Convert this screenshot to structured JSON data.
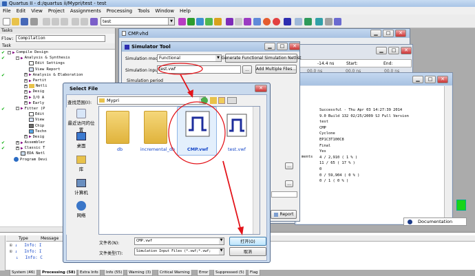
{
  "app": {
    "title": "Quartus II - d:/quartus ii/Mypri/test - test"
  },
  "menu": [
    "File",
    "Edit",
    "View",
    "Project",
    "Assignments",
    "Processing",
    "Tools",
    "Window",
    "Help"
  ],
  "toolbar": {
    "project_combo": "test"
  },
  "tasks": {
    "title": "Tasks",
    "flow_label": "Flow:",
    "flow_value": "Compilation",
    "col_task": "Task",
    "items": [
      {
        "label": "Compile Design",
        "check": true,
        "indent": 0,
        "type": "tri"
      },
      {
        "label": "Analysis & Synthesis",
        "check": true,
        "indent": 1,
        "type": "tri"
      },
      {
        "label": "Edit Settings",
        "check": false,
        "indent": 2,
        "type": "file"
      },
      {
        "label": "View Report",
        "check": false,
        "indent": 2,
        "type": "file"
      },
      {
        "label": "Analysis & Elaboration",
        "check": true,
        "indent": 2,
        "type": "tri"
      },
      {
        "label": "Partit",
        "check": false,
        "indent": 2,
        "type": "tri"
      },
      {
        "label": "Netli",
        "check": false,
        "indent": 2,
        "type": "folder"
      },
      {
        "label": "Desig",
        "check": false,
        "indent": 2,
        "type": "tri"
      },
      {
        "label": "I/O A",
        "check": false,
        "indent": 2,
        "type": "tri"
      },
      {
        "label": "Early",
        "check": false,
        "indent": 2,
        "type": "tri"
      },
      {
        "label": "Fitter (P",
        "check": true,
        "indent": 1,
        "type": "tri"
      },
      {
        "label": "Edit",
        "check": false,
        "indent": 2,
        "type": "file"
      },
      {
        "label": "View",
        "check": false,
        "indent": 2,
        "type": "file"
      },
      {
        "label": "Chip",
        "check": false,
        "indent": 2,
        "type": "file"
      },
      {
        "label": "Techn",
        "check": false,
        "indent": 2,
        "type": "file"
      },
      {
        "label": "Desig",
        "check": false,
        "indent": 2,
        "type": "tri"
      },
      {
        "label": "Assembler",
        "check": true,
        "indent": 1,
        "type": "tri"
      },
      {
        "label": "Classic T",
        "check": true,
        "indent": 1,
        "type": "tri"
      },
      {
        "label": "EDA Netl",
        "check": false,
        "indent": 1,
        "type": "file"
      },
      {
        "label": "Program Devi",
        "check": false,
        "indent": 0,
        "type": "globe"
      }
    ]
  },
  "messages": {
    "col_type": "Type",
    "col_message": "Message",
    "rows": [
      "Info: I",
      "Info: I",
      "Info: C"
    ]
  },
  "tabs": [
    "System (46)",
    "Processing (58)",
    "Extra Info",
    "Info (55)",
    "Warning (3)",
    "Critical Warning",
    "Error",
    "Suppressed (5)",
    "Flag"
  ],
  "cmp_window": {
    "title": "CMP.vhd"
  },
  "timing_window": {
    "time": "-14.4 ns",
    "start_label": "Start:",
    "end_label": "End:",
    "cells": [
      "00.0 ns",
      "00.0 ns",
      "00.0 ns"
    ]
  },
  "report": {
    "lines": [
      "Successful - Thu Apr 03 14:27:39 2014",
      "9.0 Build 132 02/25/2009 SJ Full Version",
      "test",
      "CMP",
      "Cyclone",
      "EP1C3T100C8",
      "Final",
      "Yes",
      "4 / 2,910 ( 1 % )",
      "11 / 65 ( 17 % )",
      "0",
      "0 / 59,904 ( 0 % )",
      "0 / 1 ( 0 % )"
    ],
    "row_label": "ments"
  },
  "documentation_button": "Documentation",
  "simulator": {
    "title": "Simulator Tool",
    "mode_label": "Simulation mode:",
    "mode_value": "Functional",
    "netlist_button": "Generate Functional Simulation Netlist",
    "input_label": "Simulation input:",
    "input_value": "test.vwf",
    "browse": "...",
    "add_files": "Add Multiple Files...",
    "period_label": "Simulation period",
    "report_button": "Report"
  },
  "dialog": {
    "title": "Select File",
    "look_in_label": "查找范围(I):",
    "look_in_value": "Mypri",
    "places": [
      {
        "label": "最近访问的位置",
        "icon": "recent-icon"
      },
      {
        "label": "桌面",
        "icon": "desktop-icon"
      },
      {
        "label": "库",
        "icon": "library-icon"
      },
      {
        "label": "计算机",
        "icon": "computer-icon"
      },
      {
        "label": "网络",
        "icon": "network-icon"
      }
    ],
    "files": [
      {
        "label": "db",
        "kind": "folder"
      },
      {
        "label": "incremental_db",
        "kind": "folder"
      },
      {
        "label": "CMP.vwf",
        "kind": "vwf"
      },
      {
        "label": "test.vwf",
        "kind": "vwf"
      }
    ],
    "filename_label": "文件名(N):",
    "filename_value": "CMP.vwf",
    "filetype_label": "文件类型(T):",
    "filetype_value": "Simulation Input Files (*.vwf;*.vwf;",
    "open_button": "打开(O)",
    "cancel_button": "取消"
  },
  "colors": {
    "titlebar": "#a8c4e6",
    "annotation": "#e3141a",
    "link": "#1446c8"
  }
}
